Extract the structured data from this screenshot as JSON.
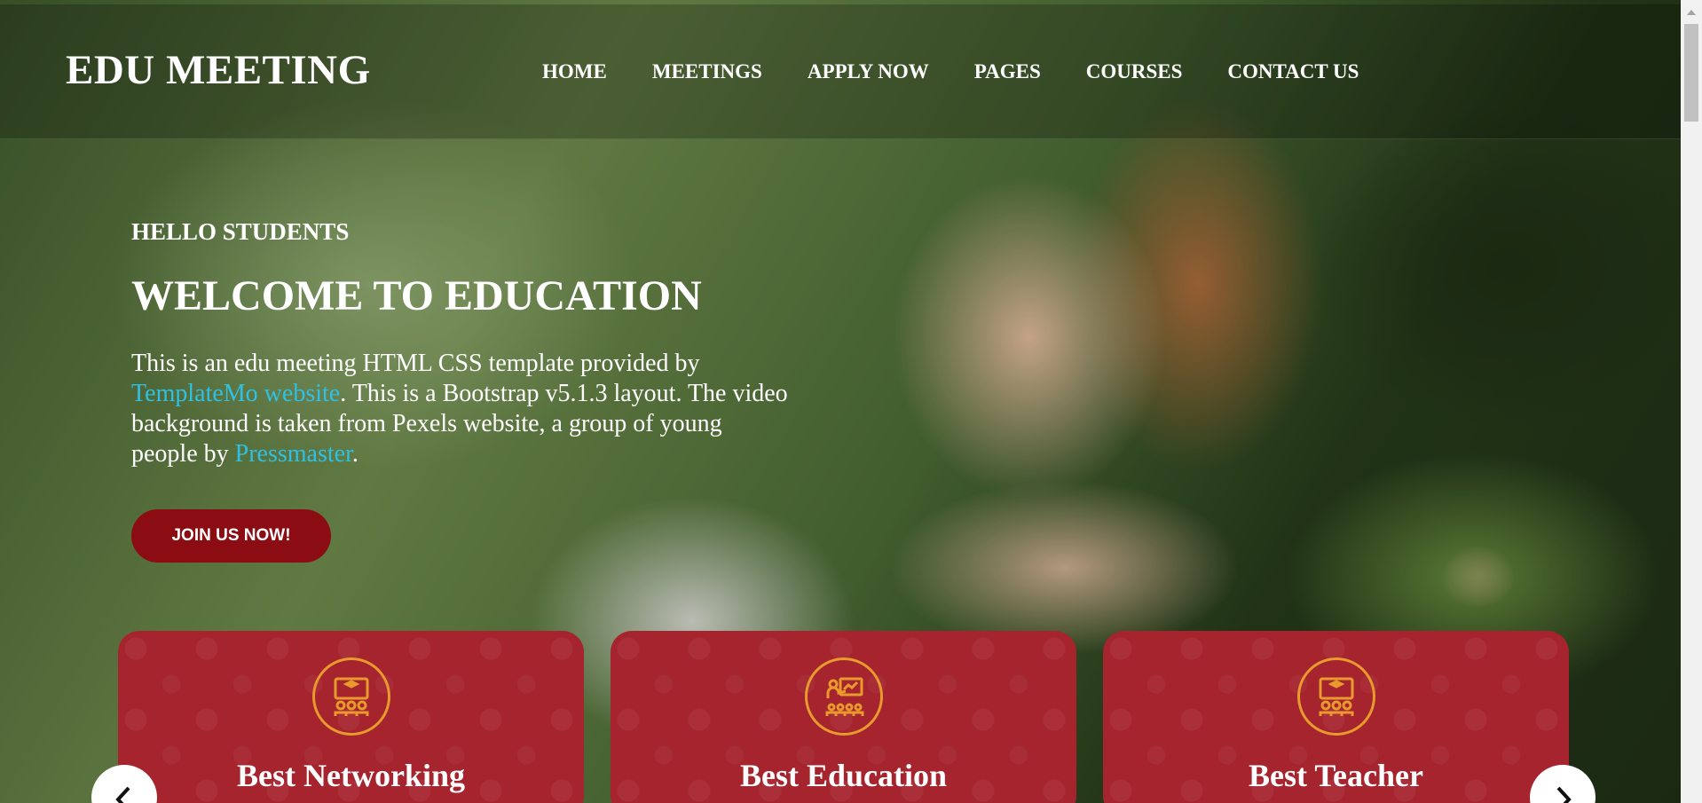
{
  "header": {
    "logo": "EDU MEETING",
    "nav": [
      "HOME",
      "MEETINGS",
      "APPLY NOW",
      "PAGES",
      "COURSES",
      "CONTACT US"
    ]
  },
  "hero": {
    "subtitle": "HELLO STUDENTS",
    "title": "WELCOME TO EDUCATION",
    "text_1": "This is an edu meeting HTML CSS template provided by ",
    "link_1": "TemplateMo website",
    "text_2": ". This is a Bootstrap v5.1.3 layout. The video background is taken from Pexels website, a group of young people by ",
    "link_2": "Pressmaster",
    "text_3": ".",
    "button": "JOIN US NOW!"
  },
  "cards": [
    {
      "title": "Best Networking",
      "icon": "meeting-presentation-icon"
    },
    {
      "title": "Best Education",
      "icon": "classroom-teacher-icon"
    },
    {
      "title": "Best Teacher",
      "icon": "meeting-presentation-icon"
    }
  ],
  "colors": {
    "accent_red": "#8b0d13",
    "card_red": "#a5242e",
    "icon_orange": "#e89a2c",
    "link_cyan": "#2ec1e6"
  }
}
